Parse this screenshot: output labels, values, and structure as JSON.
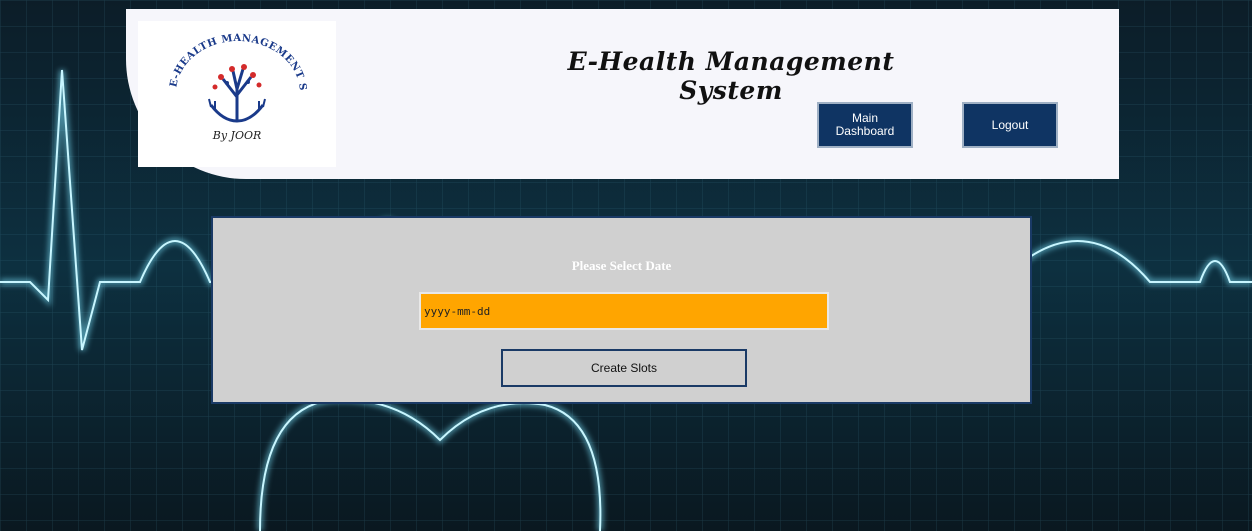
{
  "header": {
    "logo_text": "E-HEALTH MANAGEMENT SYSTEM",
    "logo_byline": "By JOOR",
    "title": "E-Health Management System",
    "buttons": {
      "main_dashboard": "Main Dashboard",
      "logout": "Logout"
    }
  },
  "panel": {
    "label": "Please Select Date",
    "date_input": {
      "placeholder": "yyyy-mm-dd",
      "value": ""
    },
    "create_button": "Create Slots"
  },
  "colors": {
    "header_bg": "#f6f6fb",
    "button_bg": "#0f3463",
    "panel_bg": "#d0d0d0",
    "input_bg": "#ffa500",
    "ecg_line": "#7fe6ff"
  },
  "icons": {
    "logo": "tree-hands-logo",
    "background": "ecg-heartbeat-background"
  }
}
